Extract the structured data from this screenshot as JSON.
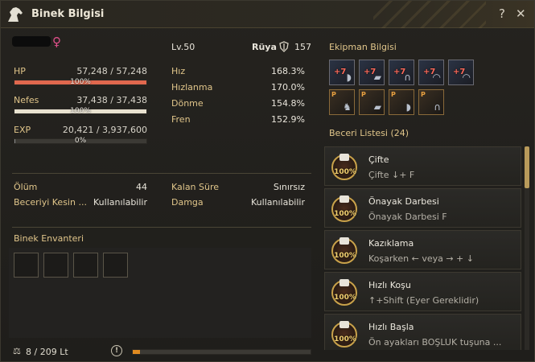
{
  "window": {
    "title": "Binek Bilgisi",
    "help": "?",
    "close": "✕"
  },
  "left": {
    "name_gender": "♀",
    "stats": [
      {
        "label": "HP",
        "value": "57,248 / 57,248",
        "pct": "100%",
        "fraction": 1.0,
        "color": "#e0684e"
      },
      {
        "label": "Nefes",
        "value": "37,438 / 37,438",
        "pct": "100%",
        "fraction": 1.0,
        "color": "#e8e2d0"
      },
      {
        "label": "EXP",
        "value": "20,421 / 3,937,600",
        "pct": "0%",
        "fraction": 0.005,
        "color": "#8a8a8a"
      }
    ],
    "misc": [
      {
        "label": "Ölüm",
        "value": "44"
      },
      {
        "label": "Beceriyi Kesin ...",
        "value": "Kullanılabilir"
      }
    ],
    "inventory": {
      "title": "Binek Envanteri",
      "weight": "8 / 209 Lt"
    }
  },
  "middle": {
    "level": "Lv.50",
    "grade_label": "Rüya",
    "grade_value": "157",
    "stats": [
      {
        "label": "Hız",
        "value": "168.3%"
      },
      {
        "label": "Hızlanma",
        "value": "170.0%"
      },
      {
        "label": "Dönme",
        "value": "154.8%"
      },
      {
        "label": "Fren",
        "value": "152.9%"
      }
    ],
    "misc": [
      {
        "label": "Kalan Süre",
        "value": "Sınırsız"
      },
      {
        "label": "Damga",
        "value": "Kullanılabilir"
      }
    ],
    "progress_fraction": 0.04
  },
  "right": {
    "equipment_title": "Ekipman Bilgisi",
    "equipment": [
      {
        "label": "+7",
        "icon": "saddle-icon"
      },
      {
        "label": "+7",
        "icon": "barding-icon"
      },
      {
        "label": "+7",
        "icon": "stirrups-icon"
      },
      {
        "label": "+7",
        "icon": "horseshoe-icon"
      },
      {
        "label": "+7",
        "icon": "horseshoe-icon"
      }
    ],
    "equipment_row2": [
      {
        "label": "P",
        "icon": "horse-head-icon"
      },
      {
        "label": "P",
        "icon": "barding-icon"
      },
      {
        "label": "P",
        "icon": "saddle-icon"
      },
      {
        "label": "P",
        "icon": "stirrups-icon"
      }
    ],
    "skills_title": "Beceri Listesi (24)",
    "skills": [
      {
        "name": "Çifte",
        "desc": "Çifte ↓+ F",
        "pct": "100%"
      },
      {
        "name": "Önayak Darbesi",
        "desc": "Önayak Darbesi F",
        "pct": "100%"
      },
      {
        "name": "Kazıklama",
        "desc": "Koşarken ← veya → + ↓",
        "pct": "100%"
      },
      {
        "name": "Hızlı Koşu",
        "desc": "↑+Shift (Eyer Gereklidir)",
        "pct": "100%"
      },
      {
        "name": "Hızlı Başla",
        "desc": "Ön ayakları BOŞLUK tuşuna ...",
        "pct": "100%"
      }
    ]
  }
}
